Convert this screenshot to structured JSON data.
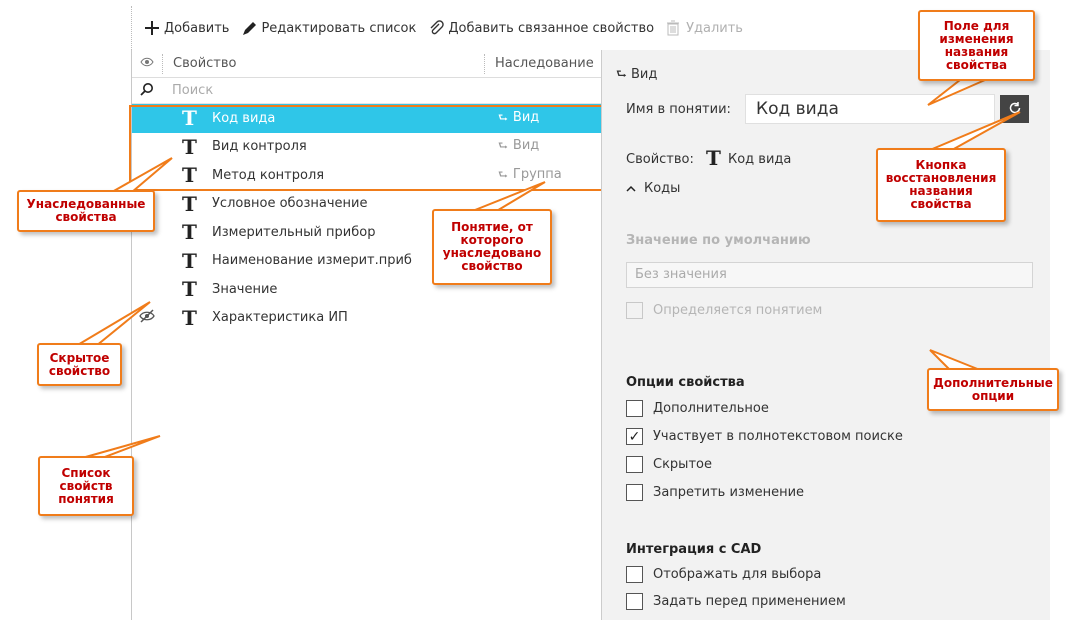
{
  "toolbar": {
    "add_label": "Добавить",
    "edit_label": "Редактировать список",
    "add_related_label": "Добавить связанное свойство",
    "delete_label": "Удалить"
  },
  "list": {
    "col_property": "Свойство",
    "col_inheritance": "Наследование",
    "search_placeholder": "Поиск",
    "rows": [
      {
        "name": "Код вида",
        "inherit": "Вид",
        "selected": true,
        "hidden": false
      },
      {
        "name": "Вид контроля",
        "inherit": "Вид",
        "selected": false,
        "hidden": false
      },
      {
        "name": "Метод контроля",
        "inherit": "Группа",
        "selected": false,
        "hidden": false
      },
      {
        "name": "Условное обозначение",
        "inherit": "",
        "selected": false,
        "hidden": false
      },
      {
        "name": "Измерительный прибор",
        "inherit": "",
        "selected": false,
        "hidden": false
      },
      {
        "name": "Наименование измерит.приб",
        "inherit": "",
        "selected": false,
        "hidden": false
      },
      {
        "name": "Значение",
        "inherit": "",
        "selected": false,
        "hidden": false
      },
      {
        "name": "Характеристика ИП",
        "inherit": "",
        "selected": false,
        "hidden": true
      }
    ]
  },
  "details": {
    "header": "Вид",
    "name_in_concept_label": "Имя в понятии:",
    "name_in_concept_value": "Код вида",
    "property_label": "Свойство:",
    "property_value": "Код вида",
    "group_label": "Коды",
    "default_value_title": "Значение по умолчанию",
    "default_value_placeholder": "Без значения",
    "defined_by_concept": "Определяется понятием",
    "options_title": "Опции свойства",
    "opt_additional": "Дополнительное",
    "opt_fulltext": "Участвует в полнотекстовом поиске",
    "opt_hidden": "Скрытое",
    "opt_forbid_change": "Запретить изменение",
    "cad_title": "Интеграция с CAD",
    "cad_display": "Отображать для выбора",
    "cad_set_before": "Задать перед применением"
  },
  "callouts": {
    "rename_field": "Поле для изменения названия свойства",
    "reset_button": "Кнопка восстановления названия свойства",
    "inherited": "Унаследованные свойства",
    "source_concept": "Понятие, от которого унаследовано свойство",
    "hidden_prop": "Скрытое свойство",
    "additional_opts": "Дополнительные опции",
    "props_list": "Список свойств понятия"
  },
  "colors": {
    "selected_row": "#2fc6e8",
    "callout_border": "#f07c1a",
    "callout_text": "#c00000"
  }
}
